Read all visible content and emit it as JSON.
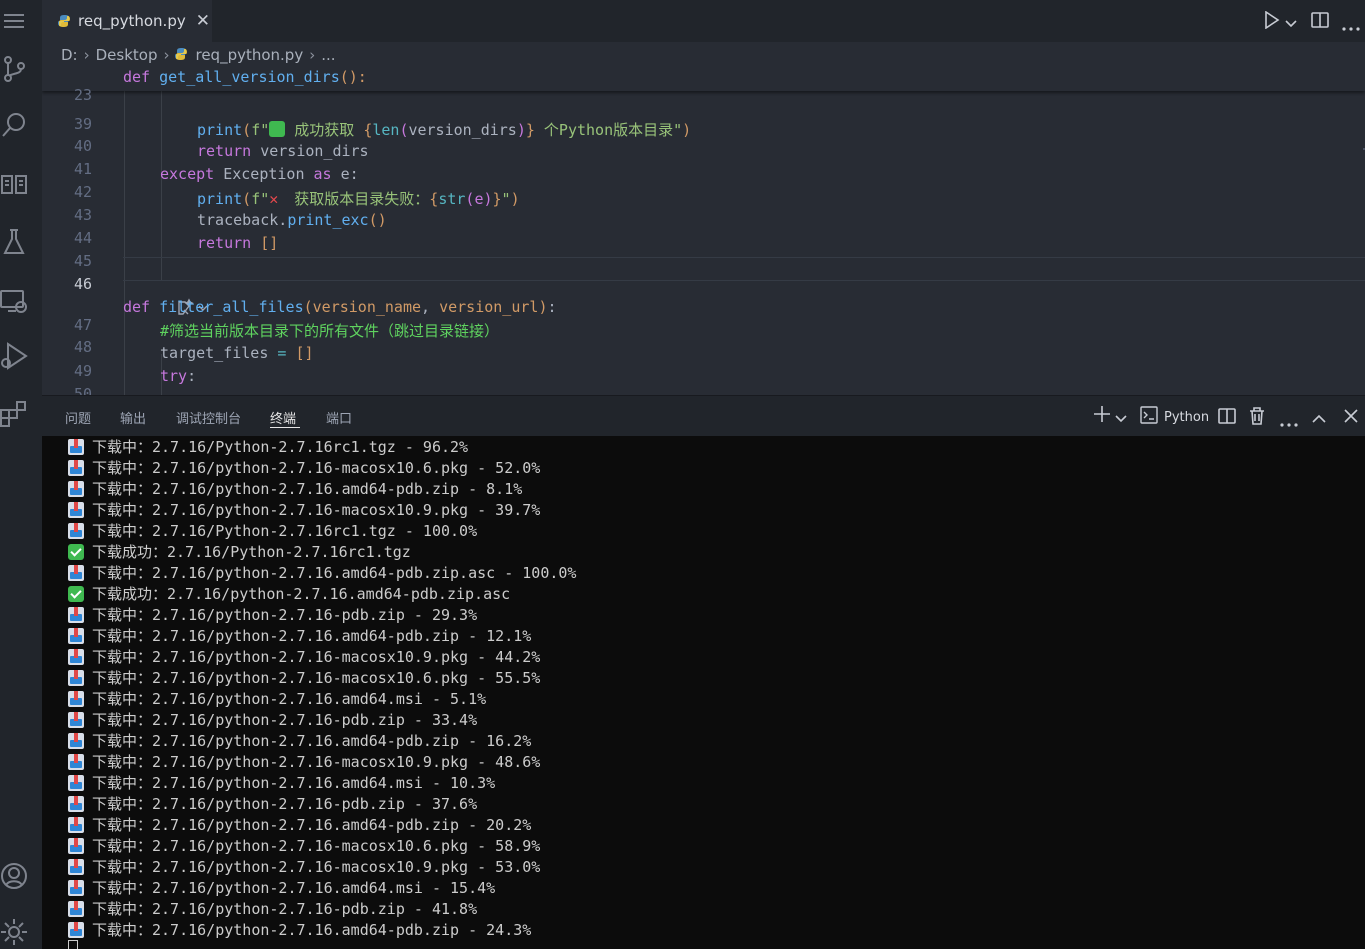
{
  "tab": {
    "filename": "req_python.py",
    "close": "✕"
  },
  "breadcrumb": {
    "drive": "D:",
    "folder": "Desktop",
    "file": "req_python.py",
    "more": "..."
  },
  "editor": {
    "sticky": {
      "line": "23",
      "kw": "def",
      "name": "get_all_version_dirs",
      "rest": "():"
    },
    "lines": {
      "l39": "39",
      "l40": "40",
      "l41": "41",
      "l42": "42",
      "l43": "43",
      "l44": "44",
      "l45": "45",
      "l46": "46",
      "l47": "47",
      "l48": "48",
      "l49": "49",
      "l50": "50"
    },
    "code": {
      "c40_print": "print",
      "c40_f": "f\"",
      "c40_msg": " 成功获取 ",
      "c40_open": "{",
      "c40_len": "len",
      "c40_p1": "(",
      "c40_var": "version_dirs",
      "c40_p2": ")",
      "c40_close": "}",
      "c40_tail": " 个Python版本目录\"",
      "c40_end": ")",
      "c41_kw": "return",
      "c41_var": " version_dirs",
      "c42_kw": "except",
      "c42_cls": " Exception ",
      "c42_as": "as",
      "c42_e": " e:",
      "c43_print": "print",
      "c43_f": "f\"",
      "c43_msg": " 获取版本目录失败：",
      "c43_open": "{",
      "c43_str": "str",
      "c43_inner": "(e)",
      "c43_close": "}",
      "c43_tail": "\"",
      "c43_end": ")",
      "c44_obj": "traceback.",
      "c44_fn": "print_exc",
      "c44_par": "()",
      "c45_kw": "return",
      "c45_val": " []",
      "c47_kw": "def",
      "c47_fn": " filter_all_files",
      "c47_p1": "(",
      "c47_a": "version_name",
      "c47_comma": ", ",
      "c47_b": "version_url",
      "c47_p2": ")",
      "c47_colon": ":",
      "c48_comment": "#筛选当前版本目录下的所有文件（跳过目录链接）",
      "c49_var": "target_files",
      "c49_eq": " = ",
      "c49_val": "[]",
      "c50_kw": "try",
      "c50_colon": ":"
    }
  },
  "panel": {
    "tabs": [
      "问题",
      "输出",
      "调试控制台",
      "终端",
      "端口"
    ],
    "active_tab": "终端",
    "shell_label": "Python"
  },
  "terminal": {
    "lines": [
      {
        "icon": "download",
        "text": "下载中：2.7.16/Python-2.7.16rc1.tgz - 96.2%"
      },
      {
        "icon": "download",
        "text": "下载中：2.7.16/python-2.7.16-macosx10.6.pkg - 52.0%"
      },
      {
        "icon": "download",
        "text": "下载中：2.7.16/python-2.7.16.amd64-pdb.zip - 8.1%"
      },
      {
        "icon": "download",
        "text": "下载中：2.7.16/python-2.7.16-macosx10.9.pkg - 39.7%"
      },
      {
        "icon": "download",
        "text": "下载中：2.7.16/Python-2.7.16rc1.tgz - 100.0%"
      },
      {
        "icon": "check",
        "text": "下载成功：2.7.16/Python-2.7.16rc1.tgz"
      },
      {
        "icon": "download",
        "text": "下载中：2.7.16/python-2.7.16.amd64-pdb.zip.asc - 100.0%"
      },
      {
        "icon": "check",
        "text": "下载成功：2.7.16/python-2.7.16.amd64-pdb.zip.asc"
      },
      {
        "icon": "download",
        "text": "下载中：2.7.16/python-2.7.16-pdb.zip - 29.3%"
      },
      {
        "icon": "download",
        "text": "下载中：2.7.16/python-2.7.16.amd64-pdb.zip - 12.1%"
      },
      {
        "icon": "download",
        "text": "下载中：2.7.16/python-2.7.16-macosx10.9.pkg - 44.2%"
      },
      {
        "icon": "download",
        "text": "下载中：2.7.16/python-2.7.16-macosx10.6.pkg - 55.5%"
      },
      {
        "icon": "download",
        "text": "下载中：2.7.16/python-2.7.16.amd64.msi - 5.1%"
      },
      {
        "icon": "download",
        "text": "下载中：2.7.16/python-2.7.16-pdb.zip - 33.4%"
      },
      {
        "icon": "download",
        "text": "下载中：2.7.16/python-2.7.16.amd64-pdb.zip - 16.2%"
      },
      {
        "icon": "download",
        "text": "下载中：2.7.16/python-2.7.16-macosx10.9.pkg - 48.6%"
      },
      {
        "icon": "download",
        "text": "下载中：2.7.16/python-2.7.16.amd64.msi - 10.3%"
      },
      {
        "icon": "download",
        "text": "下载中：2.7.16/python-2.7.16-pdb.zip - 37.6%"
      },
      {
        "icon": "download",
        "text": "下载中：2.7.16/python-2.7.16.amd64-pdb.zip - 20.2%"
      },
      {
        "icon": "download",
        "text": "下载中：2.7.16/python-2.7.16-macosx10.6.pkg - 58.9%"
      },
      {
        "icon": "download",
        "text": "下载中：2.7.16/python-2.7.16-macosx10.9.pkg - 53.0%"
      },
      {
        "icon": "download",
        "text": "下载中：2.7.16/python-2.7.16.amd64.msi - 15.4%"
      },
      {
        "icon": "download",
        "text": "下载中：2.7.16/python-2.7.16-pdb.zip - 41.8%"
      },
      {
        "icon": "download",
        "text": "下载中：2.7.16/python-2.7.16.amd64-pdb.zip - 24.3%"
      }
    ]
  }
}
